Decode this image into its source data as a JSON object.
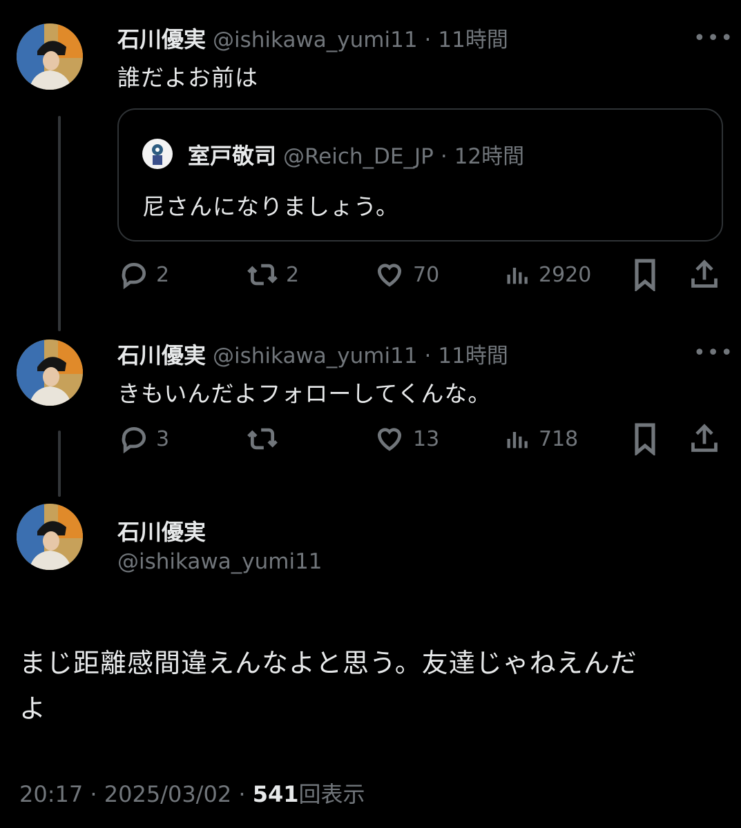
{
  "tweets": [
    {
      "author_name": "石川優実",
      "handle": "@ishikawa_yumi11",
      "separator": "·",
      "time": "11時間",
      "more": "•••",
      "text": "誰だよお前は",
      "quote": {
        "author_name": "室戸敬司",
        "handle": "@Reich_DE_JP",
        "separator": "·",
        "time": "12時間",
        "text": "尼さんになりましょう。"
      },
      "stats": {
        "replies": "2",
        "retweets": "2",
        "likes": "70",
        "views": "2920"
      }
    },
    {
      "author_name": "石川優実",
      "handle": "@ishikawa_yumi11",
      "separator": "·",
      "time": "11時間",
      "more": "•••",
      "text": "きもいんだよフォローしてくんな。",
      "stats": {
        "replies": "3",
        "retweets": "",
        "likes": "13",
        "views": "718"
      }
    }
  ],
  "main_tweet": {
    "author_name": "石川優実",
    "handle": "@ishikawa_yumi11",
    "text_line1": "まじ距離感間違えんなよと思う。友達じゃねえんだ",
    "text_line2": "よ",
    "time": "20:17",
    "sep1": "·",
    "date": "2025/03/02",
    "sep2": "·",
    "views_count": "541",
    "views_label": "回表示"
  },
  "icons": {
    "reply": "reply-icon",
    "retweet": "retweet-icon",
    "like": "heart-icon",
    "views": "views-icon",
    "bookmark": "bookmark-icon",
    "share": "share-icon"
  }
}
